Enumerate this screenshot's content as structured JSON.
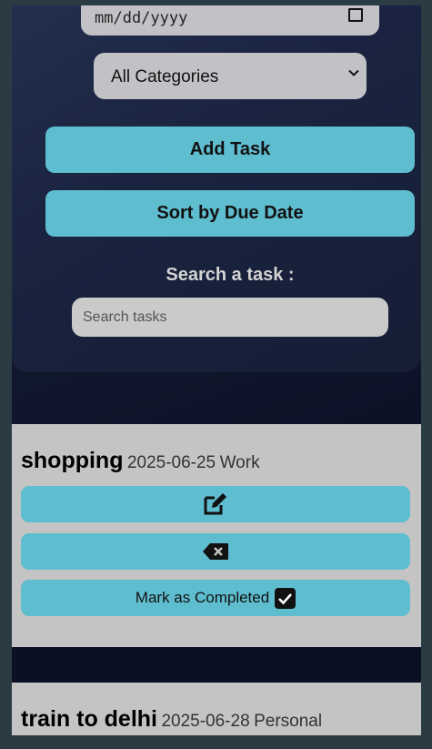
{
  "form": {
    "date_placeholder": "mm/dd/yyyy",
    "category_select": {
      "selected": "All Categories"
    },
    "add_task_label": "Add Task",
    "sort_label": "Sort by Due Date",
    "search_heading": "Search a task :",
    "search_placeholder": "Search tasks"
  },
  "tasks": [
    {
      "name": "shopping",
      "date": "2025-06-25",
      "category": "Work",
      "edit_icon": "edit-icon",
      "delete_icon": "delete-icon",
      "complete_label": "Mark as Completed",
      "complete_icon": "checkbox-checked-icon"
    },
    {
      "name": "train to delhi",
      "date": "2025-06-28",
      "category": "Personal"
    }
  ],
  "colors": {
    "accent": "#5fbdd0",
    "card": "#c4c4c4",
    "page_bg": "#2b3b44",
    "panel_bg": "#0b1024"
  }
}
